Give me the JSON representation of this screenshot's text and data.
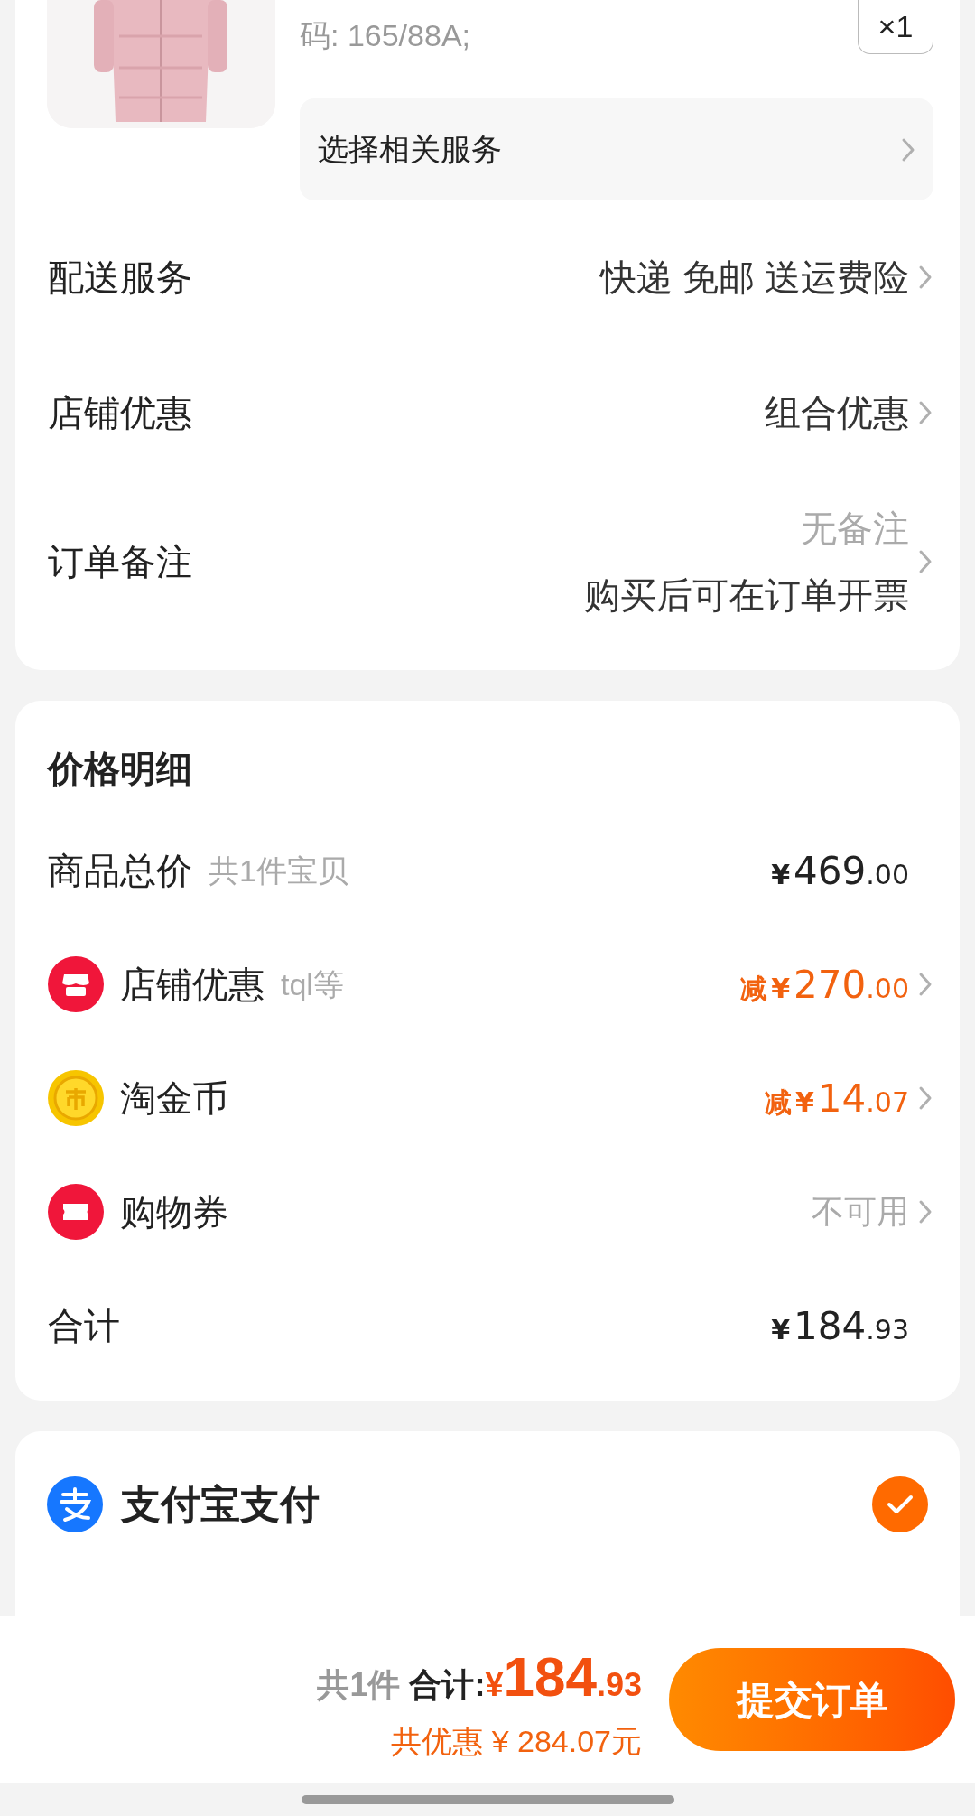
{
  "product": {
    "kind": "picture",
    "spec": "码: 165/88A;",
    "quantity": "×1",
    "service": "选择相关服务"
  },
  "order_rows": [
    {
      "label": "配送服务",
      "values": [
        "快递 免邮 送运费险"
      ]
    },
    {
      "label": "店铺优惠",
      "values": [
        "组合优惠"
      ]
    },
    {
      "label": "订单备注",
      "values": [
        "无备注",
        "购买后可在订单开票"
      ]
    }
  ],
  "price_detail": {
    "title": "价格明细",
    "rows": [
      {
        "kind": "total",
        "label": "商品总价",
        "note": "共1件宝贝",
        "prefix": "",
        "yen": "¥",
        "integer": "469",
        "decimal": ".00",
        "discount": false
      },
      {
        "kind": "shop",
        "label": "店铺优惠",
        "note": "tql等",
        "prefix": "减",
        "yen": "¥",
        "integer": "270",
        "decimal": ".00",
        "discount": true
      },
      {
        "kind": "coin",
        "label": "淘金币",
        "note": "",
        "prefix": "减",
        "yen": "¥",
        "integer": "14",
        "decimal": ".07",
        "discount": true
      },
      {
        "kind": "coupon",
        "label": "购物券",
        "status": "不可用"
      },
      {
        "kind": "sum",
        "label": "合计",
        "prefix": "",
        "yen": "¥",
        "integer": "184",
        "decimal": ".93",
        "discount": false
      }
    ]
  },
  "payment": [
    {
      "label": "支付宝支付",
      "selected": true
    }
  ],
  "footer": {
    "count": "共1件",
    "total_label": "合计:",
    "yen": "¥",
    "integer": "184",
    "decimal": ".93",
    "saving": "共优惠 ¥ 284.07元",
    "submit": "提交订单"
  }
}
